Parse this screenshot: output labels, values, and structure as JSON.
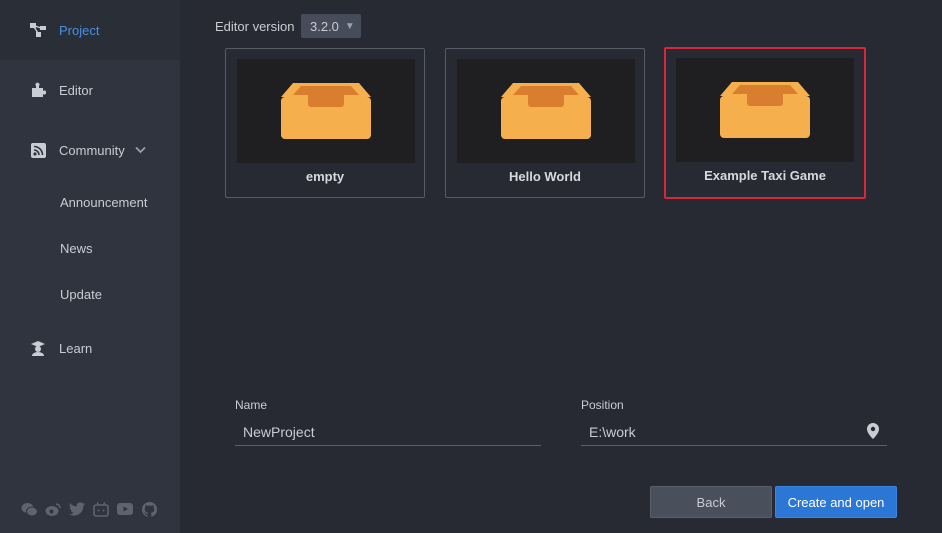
{
  "sidebar": {
    "project": "Project",
    "editor": "Editor",
    "community": "Community",
    "sub_items": [
      "Announcement",
      "News",
      "Update"
    ],
    "learn": "Learn",
    "social_icons": [
      "wechat-icon",
      "weibo-icon",
      "twitter-icon",
      "bilibili-icon",
      "youtube-icon",
      "github-icon"
    ]
  },
  "editor_version": {
    "label": "Editor version",
    "value": "3.2.0"
  },
  "templates": [
    {
      "title": "empty"
    },
    {
      "title": "Hello World"
    },
    {
      "title": "Example Taxi Game"
    }
  ],
  "form": {
    "name_label": "Name",
    "name_value": "NewProject",
    "position_label": "Position",
    "position_value": "E:\\work"
  },
  "buttons": {
    "back": "Back",
    "create": "Create and open"
  },
  "colors": {
    "accent": "#2a77d6",
    "active_nav": "#4a90e2",
    "selection": "#d8263a",
    "box": "#f5b04d"
  }
}
